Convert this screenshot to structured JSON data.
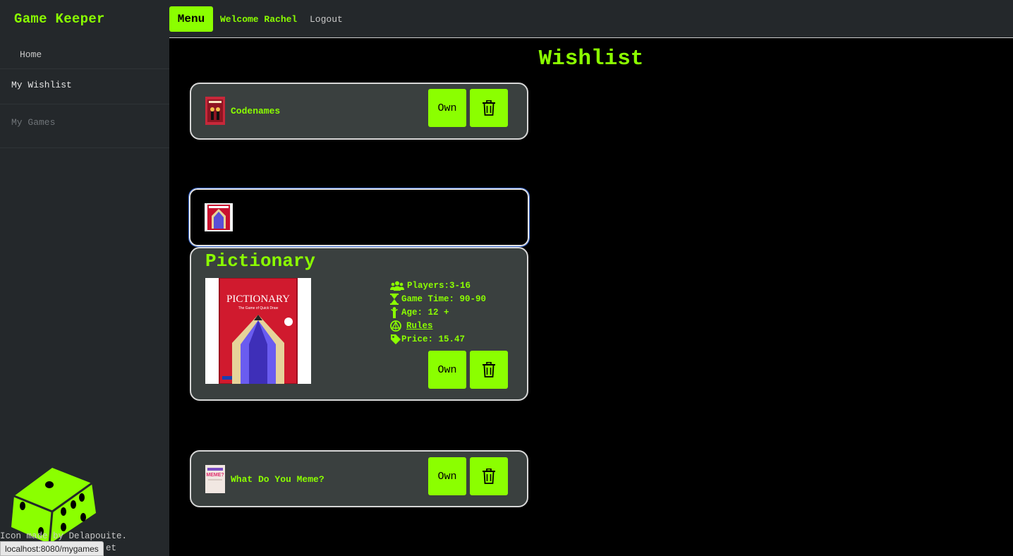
{
  "sidebar": {
    "brand": "Game Keeper",
    "items": [
      {
        "label": "Home"
      },
      {
        "label": "My Wishlist"
      },
      {
        "label": "My Games"
      }
    ],
    "credit_line1": "Icon made by Delapouite.",
    "credit_line2": "et"
  },
  "topbar": {
    "menu_label": "Menu",
    "welcome": "Welcome Rachel",
    "logout": "Logout"
  },
  "page": {
    "title": "Wishlist"
  },
  "wishlist": [
    {
      "name": "Codenames",
      "own_label": "Own"
    },
    {
      "name": "Pictionary",
      "own_label": "Own",
      "players": "Players:3-16",
      "game_time": "Game Time: 90-90",
      "age": "Age: 12 +",
      "rules": "Rules",
      "price": "Price: 15.47"
    },
    {
      "name": "What Do You Meme?",
      "own_label": "Own"
    }
  ],
  "status_url": "localhost:8080/mygames",
  "colors": {
    "accent": "#8bff00",
    "sidebar_bg": "#24282b",
    "card_bg": "#3a403f",
    "page_bg": "#000000"
  },
  "icons": [
    "dice-icon",
    "trash-icon",
    "players-icon",
    "hourglass-icon",
    "age-icon",
    "rules-icon",
    "price-tag-icon"
  ]
}
